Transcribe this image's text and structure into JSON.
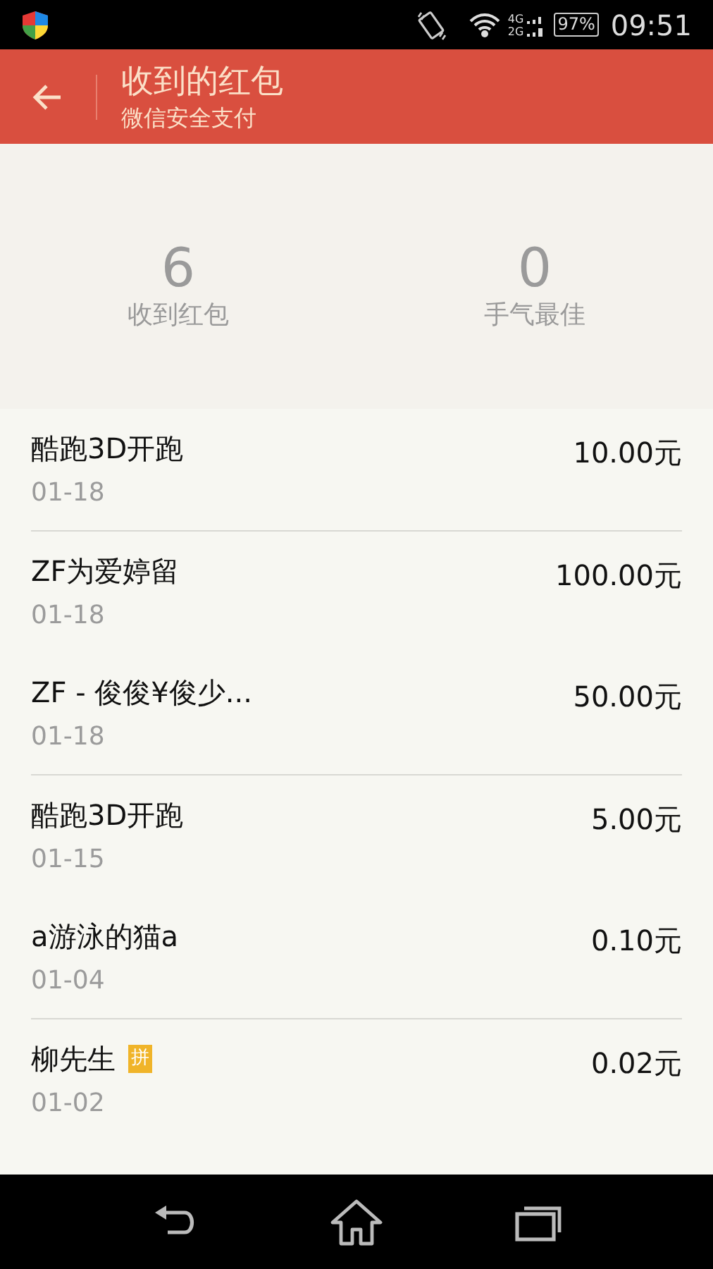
{
  "status_bar": {
    "network_top": "4G",
    "network_bottom": "2G",
    "battery": "97%",
    "time": "09:51"
  },
  "header": {
    "title": "收到的红包",
    "subtitle": "微信安全支付"
  },
  "summary": {
    "stats": [
      {
        "value": "6",
        "label": "收到红包"
      },
      {
        "value": "0",
        "label": "手气最佳"
      }
    ]
  },
  "rows": [
    {
      "name": "酷跑3D开跑",
      "date": "01-18",
      "amount": "10.00元",
      "divider": true
    },
    {
      "name": "ZF为爱婷留",
      "date": "01-18",
      "amount": "100.00元",
      "divider": false
    },
    {
      "name": "ZF - 俊俊¥俊少...",
      "date": "01-18",
      "amount": "50.00元",
      "divider": true
    },
    {
      "name": "酷跑3D开跑",
      "date": "01-15",
      "amount": "5.00元",
      "divider": false
    },
    {
      "name": "a游泳的猫a",
      "date": "01-04",
      "amount": "0.10元",
      "divider": true
    },
    {
      "name": "柳先生",
      "badge": "拼",
      "date": "01-02",
      "amount": "0.02元",
      "divider": false
    }
  ]
}
